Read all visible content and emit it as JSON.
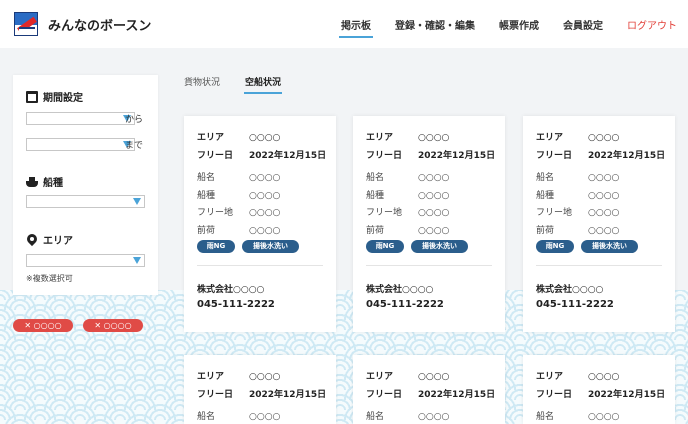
{
  "header": {
    "title": "みんなのボースン",
    "nav": [
      {
        "label": "掲示板",
        "active": true
      },
      {
        "label": "登録・確認・編集",
        "active": false
      },
      {
        "label": "帳票作成",
        "active": false
      },
      {
        "label": "会員設定",
        "active": false
      },
      {
        "label": "ログアウト",
        "active": false
      }
    ],
    "accent_color": "#4aa3d8",
    "logout_color": "#e2413a"
  },
  "filter": {
    "period_label": "期間設定",
    "from_suffix": "から",
    "to_suffix": "まで",
    "ship_type_label": "船種",
    "area_label": "エリア",
    "note": "※複数選択可"
  },
  "chips": [
    {
      "label": "✕ ○○○○"
    },
    {
      "label": "✕ ○○○○"
    }
  ],
  "tabs": [
    {
      "label": "貨物状況",
      "active": false
    },
    {
      "label": "空船状況",
      "active": true
    }
  ],
  "card_labels": {
    "area": "エリア",
    "free_day": "フリー日",
    "ship_name": "船名",
    "ship_type": "船種",
    "free_place": "フリー地",
    "previous_cargo": "前荷"
  },
  "cards": [
    {
      "area": "○○○○",
      "free_day": "2022年12月15日",
      "ship_name": "○○○○",
      "ship_type": "○○○○",
      "free_place": "○○○○",
      "previous_cargo": "○○○○",
      "tags": [
        "雨NG",
        "揚後水洗い"
      ],
      "company": "株式会社○○○○",
      "phone": "045-111-2222"
    },
    {
      "area": "○○○○",
      "free_day": "2022年12月15日",
      "ship_name": "○○○○",
      "ship_type": "○○○○",
      "free_place": "○○○○",
      "previous_cargo": "○○○○",
      "tags": [
        "雨NG",
        "揚後水洗い"
      ],
      "company": "株式会社○○○○",
      "phone": "045-111-2222"
    },
    {
      "area": "○○○○",
      "free_day": "2022年12月15日",
      "ship_name": "○○○○",
      "ship_type": "○○○○",
      "free_place": "○○○○",
      "previous_cargo": "○○○○",
      "tags": [
        "雨NG",
        "揚後水洗い"
      ],
      "company": "株式会社○○○○",
      "phone": "045-111-2222"
    },
    {
      "area": "○○○○",
      "free_day": "2022年12月15日",
      "ship_name": "○○○○"
    },
    {
      "area": "○○○○",
      "free_day": "2022年12月15日",
      "ship_name": "○○○○"
    },
    {
      "area": "○○○○",
      "free_day": "2022年12月15日",
      "ship_name": "○○○○"
    }
  ],
  "colors": {
    "tag_bg": "#2b5e8c",
    "chip_bg": "#e04b46",
    "wave": "#cfe9f4"
  }
}
